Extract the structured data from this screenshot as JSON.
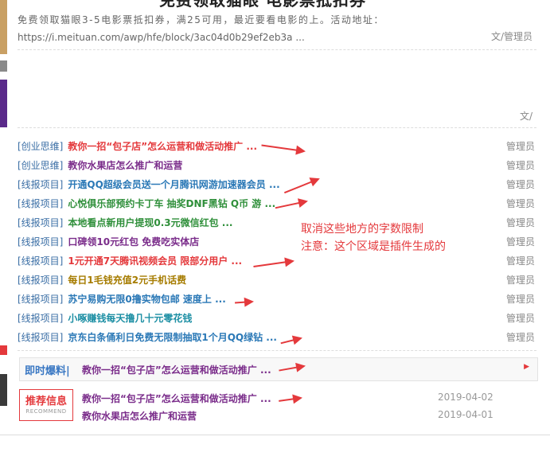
{
  "top_title_fragment": "免费领取猫眼 电影票抵扣券",
  "excerpt": {
    "text": "免费领取猫眼3-5电影票抵扣券，满25可用，最近要看电影的上。活动地址：",
    "url": "https://i.meituan.com/awp/hfe/block/3ac04d0b29ef2eb3a ..."
  },
  "post1_author": "文/管理员",
  "post2_author": "文/",
  "list": [
    {
      "category": "[创业思维]",
      "title": "教你一招“包子店”怎么运营和做活动推广 ...",
      "author": "管理员",
      "color": "#e4393c"
    },
    {
      "category": "[创业思维]",
      "title": "教你水果店怎么推广和运营",
      "author": "管理员",
      "color": "#7a2c8a"
    },
    {
      "category": "[线报项目]",
      "title": "开通QQ超级会员送一个月腾讯网游加速器会员 ...",
      "author": "管理员",
      "color": "#2a78b6"
    },
    {
      "category": "[线报项目]",
      "title": "心悦俱乐部预约卡丁车 抽奖DNF黑钻 Q币 游 ...",
      "author": "管理员",
      "color": "#2f8f3a"
    },
    {
      "category": "[线报项目]",
      "title": "本地看点新用户提现0.3元微信红包 ...",
      "author": "管理员",
      "color": "#2f8f3a"
    },
    {
      "category": "[线报项目]",
      "title": "口碑领10元红包 免费吃实体店",
      "author": "管理员",
      "color": "#7a2c8a"
    },
    {
      "category": "[线报项目]",
      "title": "1元开通7天腾讯视频会员 限部分用户 ...",
      "author": "管理员",
      "color": "#e4393c"
    },
    {
      "category": "[线报项目]",
      "title": "每日1毛钱充值2元手机话费",
      "author": "管理员",
      "color": "#a67c00"
    },
    {
      "category": "[线报项目]",
      "title": "苏宁易购无限0撸实物包邮 速度上 ...",
      "author": "管理员",
      "color": "#2a78b6"
    },
    {
      "category": "[线报项目]",
      "title": "小啄赚钱每天撸几十元零花钱",
      "author": "管理员",
      "color": "#1d8fa4"
    },
    {
      "category": "[线报项目]",
      "title": "京东白条俑利日免费无限制抽取1个月QQ绿钻 ...",
      "author": "管理员",
      "color": "#2a78b6"
    }
  ],
  "annotation": {
    "line1": "取消这些地方的字数限制",
    "line2": "注意：这个区域是插件生成的"
  },
  "ticker": {
    "label": "即时爆料|",
    "text": "教你一招“包子店”怎么运营和做活动推广 ...",
    "arrow": "▶"
  },
  "recommend": {
    "label_cn": "推荐信息",
    "label_en": "RECOMMEND",
    "items": [
      {
        "title": "教你一招“包子店”怎么运营和做活动推广 ...",
        "date": "2019-04-02"
      },
      {
        "title": "教你水果店怎么推广和运营",
        "date": "2019-04-01"
      }
    ]
  }
}
